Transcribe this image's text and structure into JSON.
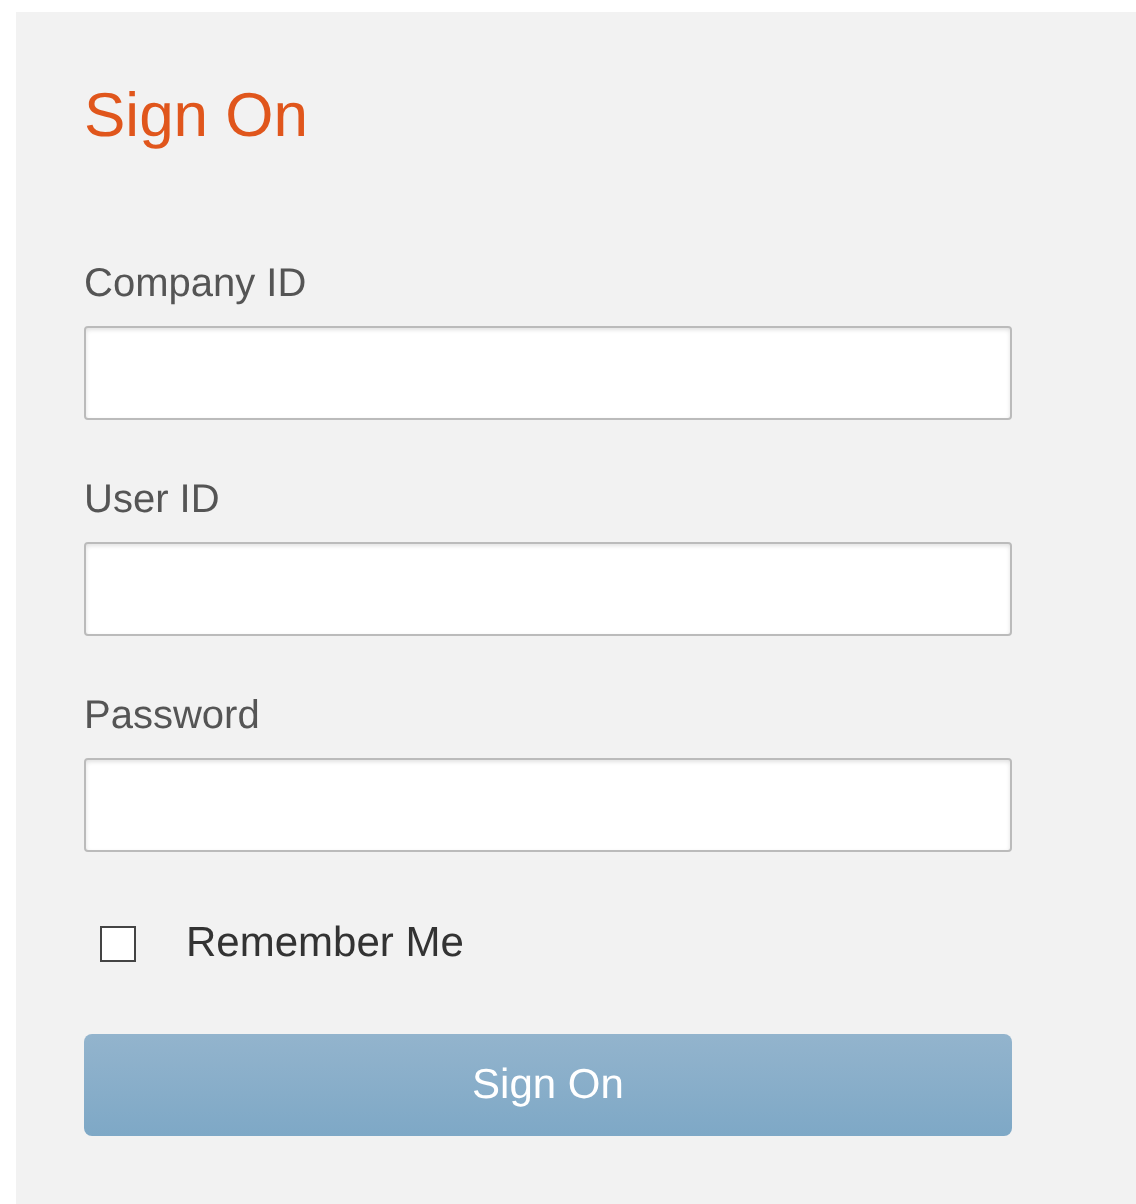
{
  "title": "Sign On",
  "fields": [
    {
      "label": "Company ID"
    },
    {
      "label": "User ID"
    },
    {
      "label": "Password"
    }
  ],
  "remember": {
    "label": "Remember Me",
    "checked": false
  },
  "submit": {
    "label": "Sign On",
    "disabled": true
  }
}
